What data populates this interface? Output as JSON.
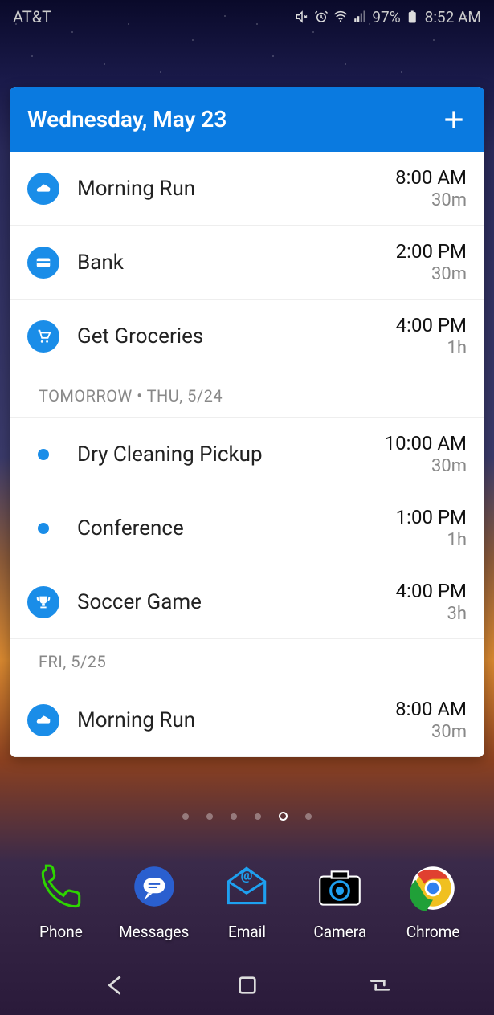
{
  "status": {
    "carrier": "AT&T",
    "battery": "97%",
    "time": "8:52 AM"
  },
  "widget": {
    "header_date": "Wednesday, May 23",
    "sections": [
      {
        "label": null,
        "events": [
          {
            "icon": "shoe",
            "title": "Morning Run",
            "time": "8:00 AM",
            "duration": "30m"
          },
          {
            "icon": "card",
            "title": "Bank",
            "time": "2:00 PM",
            "duration": "30m"
          },
          {
            "icon": "cart",
            "title": "Get Groceries",
            "time": "4:00 PM",
            "duration": "1h"
          }
        ]
      },
      {
        "label": "TOMORROW • THU, 5/24",
        "events": [
          {
            "icon": "dot",
            "title": "Dry Cleaning Pickup",
            "time": "10:00 AM",
            "duration": "30m"
          },
          {
            "icon": "dot",
            "title": "Conference",
            "time": "1:00 PM",
            "duration": "1h"
          },
          {
            "icon": "trophy",
            "title": "Soccer Game",
            "time": "4:00 PM",
            "duration": "3h"
          }
        ]
      },
      {
        "label": "FRI, 5/25",
        "events": [
          {
            "icon": "shoe",
            "title": "Morning Run",
            "time": "8:00 AM",
            "duration": "30m"
          }
        ]
      }
    ]
  },
  "page_indicator": {
    "count": 6,
    "active_index": 4
  },
  "dock": {
    "items": [
      {
        "label": "Phone",
        "icon": "phone"
      },
      {
        "label": "Messages",
        "icon": "messages"
      },
      {
        "label": "Email",
        "icon": "email"
      },
      {
        "label": "Camera",
        "icon": "camera"
      },
      {
        "label": "Chrome",
        "icon": "chrome"
      }
    ]
  }
}
